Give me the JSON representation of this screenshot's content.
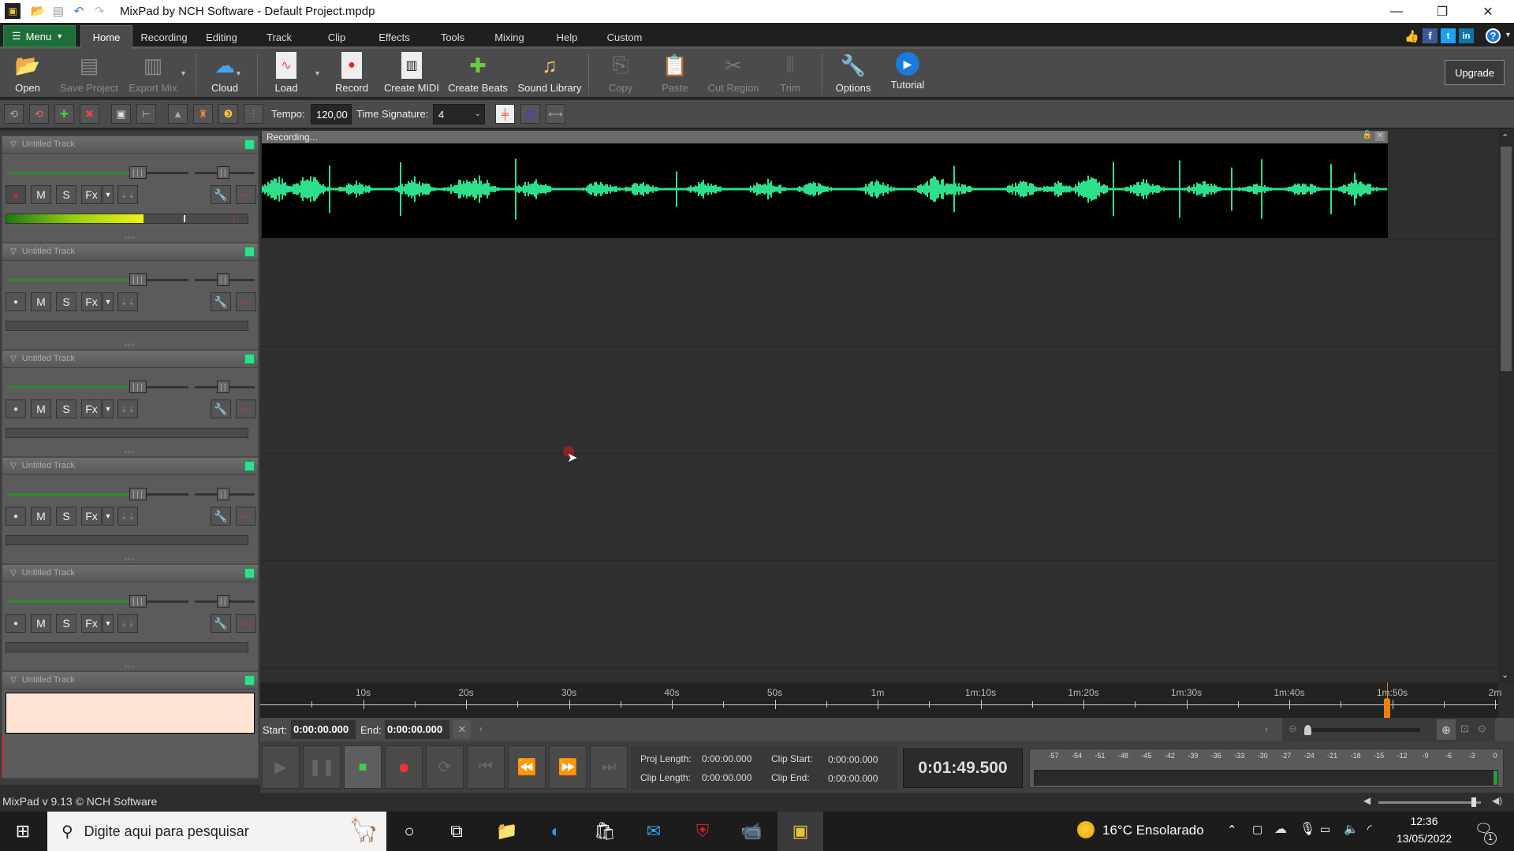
{
  "window": {
    "title": "MixPad by NCH Software - Default Project.mpdp",
    "controls": {
      "minimize": "—",
      "maximize": "❐",
      "close": "✕"
    }
  },
  "menubar": {
    "menu_label": "Menu",
    "tabs": [
      "Home",
      "Recording",
      "Editing",
      "Track",
      "Clip",
      "Effects",
      "Tools",
      "Mixing",
      "Help",
      "Custom"
    ],
    "active_tab": "Home",
    "social": [
      "like-icon",
      "facebook-icon",
      "twitter-icon",
      "linkedin-icon",
      "help-icon"
    ]
  },
  "ribbon": {
    "buttons": [
      {
        "label": "Open",
        "icon": "folder-open-icon",
        "enabled": true
      },
      {
        "label": "Save Project",
        "icon": "save-icon",
        "enabled": false
      },
      {
        "label": "Export Mix",
        "icon": "export-icon",
        "enabled": false
      },
      {
        "label": "Cloud",
        "icon": "cloud-icon",
        "enabled": true
      },
      {
        "label": "Load",
        "icon": "load-audio-icon",
        "enabled": true
      },
      {
        "label": "Record",
        "icon": "record-audio-icon",
        "enabled": true
      },
      {
        "label": "Create MIDI",
        "icon": "midi-icon",
        "enabled": true
      },
      {
        "label": "Create Beats",
        "icon": "beats-icon",
        "enabled": true
      },
      {
        "label": "Sound Library",
        "icon": "sound-library-icon",
        "enabled": true
      },
      {
        "label": "Copy",
        "icon": "copy-icon",
        "enabled": false
      },
      {
        "label": "Paste",
        "icon": "paste-icon",
        "enabled": false
      },
      {
        "label": "Cut Region",
        "icon": "cut-region-icon",
        "enabled": false
      },
      {
        "label": "Trim",
        "icon": "trim-icon",
        "enabled": false
      },
      {
        "label": "Options",
        "icon": "options-icon",
        "enabled": true
      },
      {
        "label": "Tutorial",
        "icon": "tutorial-icon",
        "enabled": true
      }
    ],
    "upgrade_label": "Upgrade"
  },
  "toolbar2": {
    "tempo_label": "Tempo:",
    "tempo_value": "120,00",
    "time_signature_label": "Time Signature:",
    "time_signature_value": "4"
  },
  "tracks": [
    {
      "name": "Untitled Track",
      "armed": true,
      "level": 0.57,
      "mute": "M",
      "solo": "S",
      "fx": "Fx"
    },
    {
      "name": "Untitled Track",
      "armed": false,
      "level": 0,
      "mute": "M",
      "solo": "S",
      "fx": "Fx"
    },
    {
      "name": "Untitled Track",
      "armed": false,
      "level": 0,
      "mute": "M",
      "solo": "S",
      "fx": "Fx"
    },
    {
      "name": "Untitled Track",
      "armed": false,
      "level": 0,
      "mute": "M",
      "solo": "S",
      "fx": "Fx"
    },
    {
      "name": "Untitled Track",
      "armed": false,
      "level": 0,
      "mute": "M",
      "solo": "S",
      "fx": "Fx"
    },
    {
      "name": "Untitled Track",
      "armed": false,
      "level": 0,
      "mute": "M",
      "solo": "S",
      "fx": "Fx"
    }
  ],
  "clip": {
    "label": "Recording...",
    "color": "#2ee08b"
  },
  "ruler": {
    "labels": [
      "10s",
      "20s",
      "30s",
      "40s",
      "50s",
      "1m",
      "1m:10s",
      "1m:20s",
      "1m:30s",
      "1m:40s",
      "1m:50s",
      "2m"
    ],
    "playhead_seconds": 109.5
  },
  "range": {
    "start_label": "Start:",
    "start_value": "0:00:00.000",
    "end_label": "End:",
    "end_value": "0:00:00.000"
  },
  "info": {
    "proj_length_label": "Proj Length:",
    "proj_length_value": "0:00:00.000",
    "clip_start_label": "Clip Start:",
    "clip_start_value": "0:00:00.000",
    "clip_length_label": "Clip Length:",
    "clip_length_value": "0:00:00.000",
    "clip_end_label": "Clip End:",
    "clip_end_value": "0:00:00.000"
  },
  "clock": "0:01:49.500",
  "vu_labels": [
    "-57",
    "-54",
    "-51",
    "-48",
    "-45",
    "-42",
    "-39",
    "-36",
    "-33",
    "-30",
    "-27",
    "-24",
    "-21",
    "-18",
    "-15",
    "-12",
    "-9",
    "-6",
    "-3",
    "0"
  ],
  "status": {
    "version": "MixPad v 9.13 © NCH Software",
    "master_volume": 0.93
  },
  "taskbar": {
    "search_placeholder": "Digite aqui para pesquisar",
    "weather": "16°C  Ensolarado",
    "time": "12:36",
    "date": "13/05/2022",
    "notifications": "1"
  }
}
